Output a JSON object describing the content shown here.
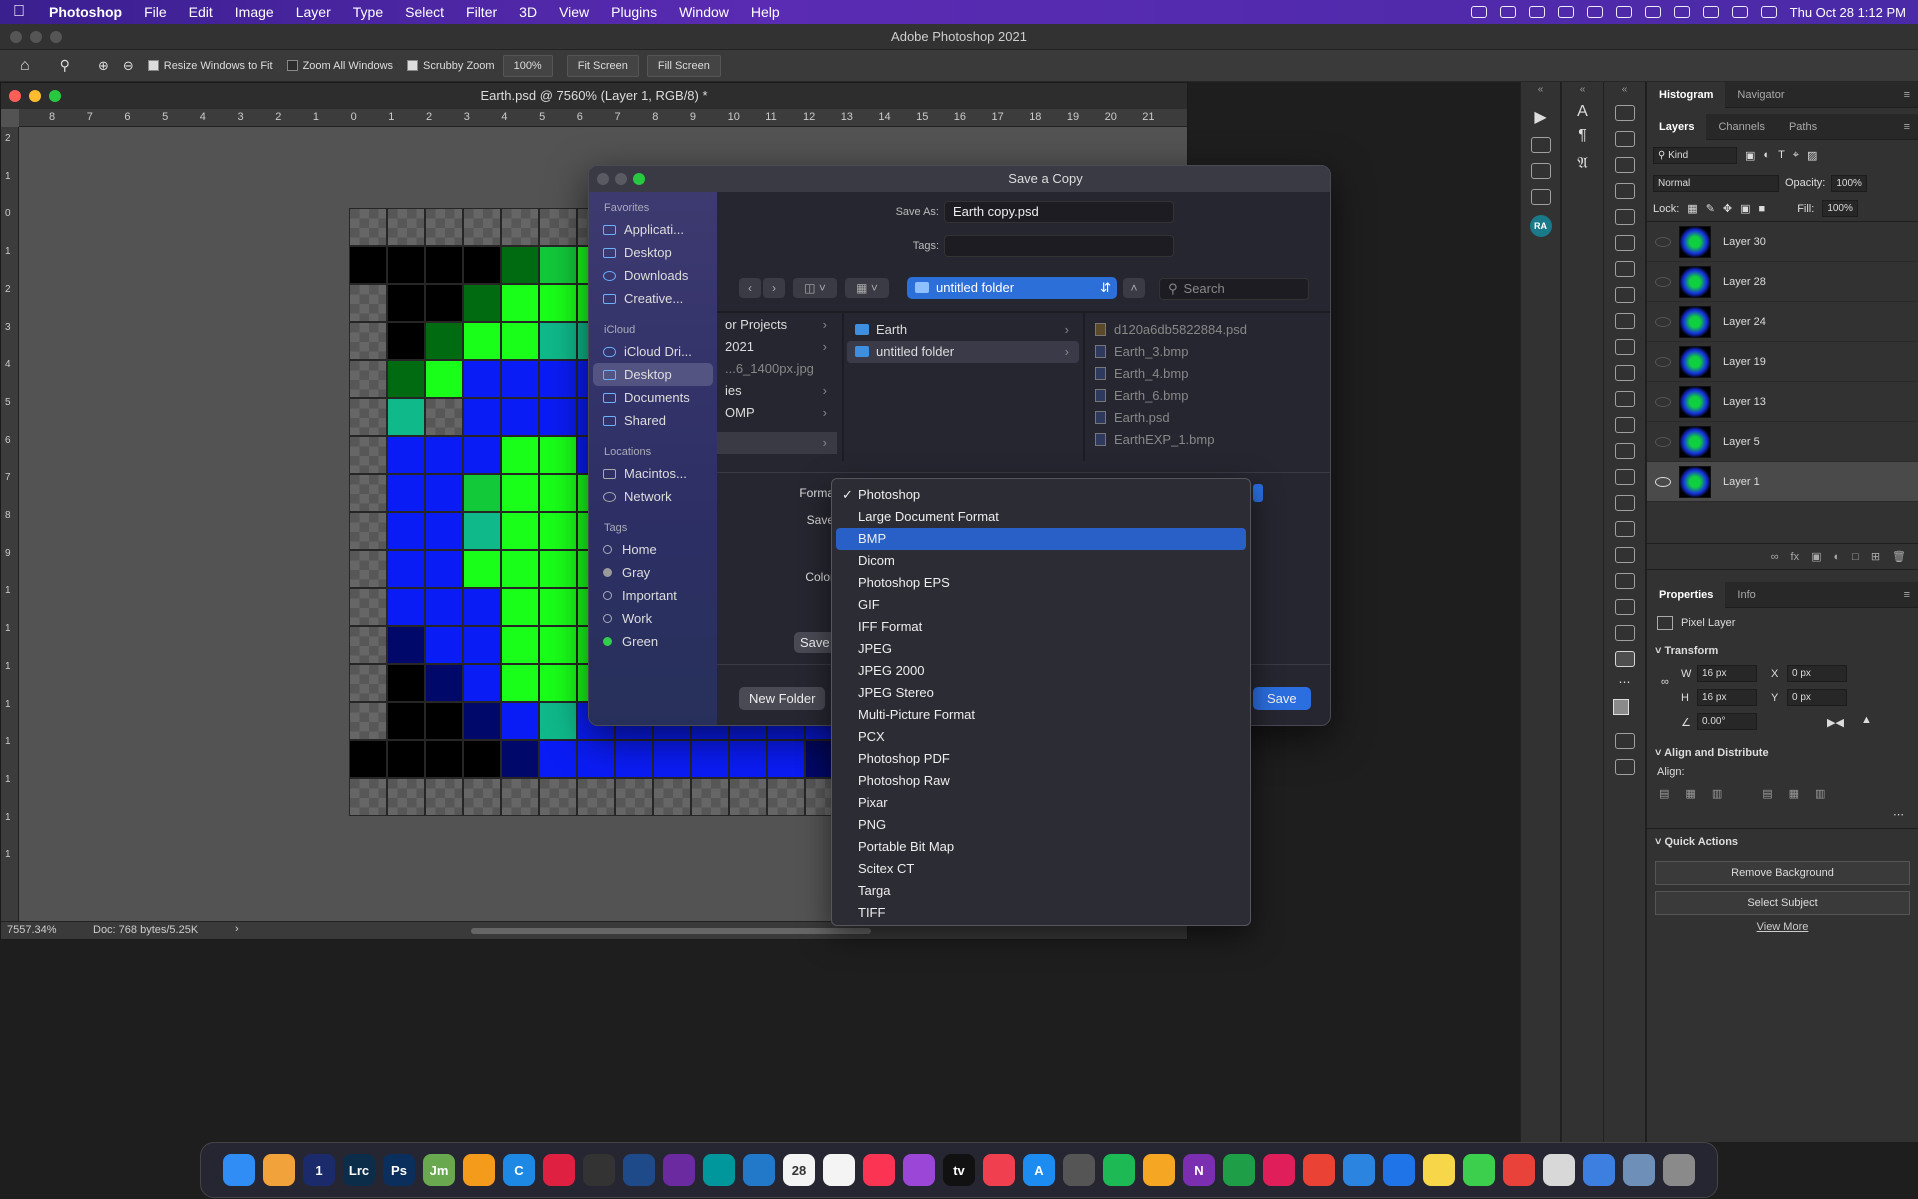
{
  "menubar": {
    "app": "Photoshop",
    "items": [
      "File",
      "Edit",
      "Image",
      "Layer",
      "Type",
      "Select",
      "Filter",
      "3D",
      "View",
      "Plugins",
      "Window",
      "Help"
    ],
    "clock": "Thu Oct 28  1:12 PM"
  },
  "app_title": "Adobe Photoshop 2021",
  "options": {
    "resize_windows": "Resize Windows to Fit",
    "zoom_all": "Zoom All Windows",
    "scrubby_zoom": "Scrubby Zoom",
    "zoom_value": "100%",
    "fit_screen": "Fit Screen",
    "fill_screen": "Fill Screen"
  },
  "document": {
    "tab_title": "Earth.psd @ 7560% (Layer 1, RGB/8) *",
    "ruler_h": [
      "8",
      "7",
      "6",
      "5",
      "4",
      "3",
      "2",
      "1",
      "0",
      "1",
      "2",
      "3",
      "4",
      "5",
      "6",
      "7",
      "8",
      "9",
      "10",
      "11",
      "12",
      "13",
      "14",
      "15",
      "16",
      "17",
      "18",
      "19",
      "20",
      "21"
    ],
    "ruler_v": [
      "2",
      "1",
      "0",
      "1",
      "2",
      "3",
      "4",
      "5",
      "6",
      "7",
      "8",
      "9",
      "1",
      "1",
      "1",
      "1",
      "1",
      "1",
      "1",
      "1"
    ],
    "zoom_status": "7557.34%",
    "doc_status": "Doc: 768 bytes/5.25K",
    "pixel_rows": [
      "cccccccccccccccc",
      "kkkkdglllggbkkkk",
      "ckkdlllbbbbbbkkc",
      "ckdllttbbbbbbbkc",
      "cdlbbbbbbbbbbbkc",
      "ctcbbbbbbbbbbbbc",
      "cbbbllbbbbbbbbbc",
      "cbbglllbbbbbbbbc",
      "cbbtlllbbbbbbbbc",
      "cbblllllbbbbbbbc",
      "cbbblllllbbbbbbc",
      "cnbbllllbbbbbbbc",
      "cknbllllbbbbbbbc",
      "ckknbtbbbbbbbnkc",
      "kkkknbbbbbbbnkkk",
      "cccccccccccccccc"
    ],
    "pixel_colors": {
      "c": "#5f5f5f",
      "k": "#000000",
      "d": "#006b10",
      "g": "#12c93a",
      "l": "#19ff19",
      "t": "#0fb98a",
      "b": "#0a1cf5",
      "n": "#00086a"
    }
  },
  "dialog": {
    "title": "Save a Copy",
    "save_as_label": "Save As:",
    "save_as_value": "Earth copy.psd",
    "tags_label": "Tags:",
    "location": "untitled folder",
    "search_placeholder": "Search",
    "sidebar": {
      "favorites_head": "Favorites",
      "favorites": [
        "Applicati...",
        "Desktop",
        "Downloads",
        "Creative..."
      ],
      "icloud_head": "iCloud",
      "icloud": [
        "iCloud Dri...",
        "Desktop",
        "Documents",
        "Shared"
      ],
      "locations_head": "Locations",
      "locations": [
        "Macintos...",
        "Network"
      ],
      "tags_head": "Tags",
      "tags": [
        {
          "name": "Home",
          "color": "#00000000"
        },
        {
          "name": "Gray",
          "color": "#9a9a9a"
        },
        {
          "name": "Important",
          "color": "#00000000"
        },
        {
          "name": "Work",
          "color": "#00000000"
        },
        {
          "name": "Green",
          "color": "#2fcf4b"
        }
      ]
    },
    "col1": [
      "or Projects",
      "2021",
      "...6_1400px.jpg",
      "ies",
      "OMP"
    ],
    "col2": [
      "Earth",
      "untitled folder"
    ],
    "col3": [
      "d120a6db5822884.psd",
      "Earth_3.bmp",
      "Earth_4.bmp",
      "Earth_6.bmp",
      "Earth.psd",
      "EarthEXP_1.bmp"
    ],
    "format_label": "Forma",
    "save_label": "Save",
    "color_label": "Color",
    "save_small": "Save",
    "new_folder": "New Folder",
    "save_button": "Save"
  },
  "format_menu": {
    "checked": "Photoshop",
    "items": [
      "Photoshop",
      "Large Document Format",
      "BMP",
      "Dicom",
      "Photoshop EPS",
      "GIF",
      "IFF Format",
      "JPEG",
      "JPEG 2000",
      "JPEG Stereo",
      "Multi-Picture Format",
      "PCX",
      "Photoshop PDF",
      "Photoshop Raw",
      "Pixar",
      "PNG",
      "Portable Bit Map",
      "Scitex CT",
      "Targa",
      "TIFF"
    ],
    "highlighted": "BMP"
  },
  "panels": {
    "top_tabs": [
      "Histogram",
      "Navigator"
    ],
    "layer_tabs": [
      "Layers",
      "Channels",
      "Paths"
    ],
    "kind": "Kind",
    "blend": "Normal",
    "opacity_label": "Opacity:",
    "opacity": "100%",
    "lock_label": "Lock:",
    "fill_label": "Fill:",
    "fill": "100%",
    "layers": [
      "Layer 30",
      "Layer 28",
      "Layer 24",
      "Layer 19",
      "Layer 13",
      "Layer 5",
      "Layer 1"
    ],
    "prop_tabs": [
      "Properties",
      "Info"
    ],
    "pixel_layer": "Pixel Layer",
    "transform": "Transform",
    "w_label": "W",
    "w": "16 px",
    "h_label": "H",
    "h": "16 px",
    "x_label": "X",
    "x": "0 px",
    "y_label": "Y",
    "y": "0 px",
    "angle": "0.00°",
    "align_head": "Align and Distribute",
    "align_label": "Align:",
    "quick_actions": "Quick Actions",
    "remove_bg": "Remove Background",
    "select_subject": "Select Subject",
    "view_more": "View More",
    "avatar": "RA"
  },
  "dock": [
    {
      "label": "",
      "color": "#2f8df5"
    },
    {
      "label": "",
      "color": "#f2a23a"
    },
    {
      "label": "1",
      "color": "#1b2a6b"
    },
    {
      "label": "Lrc",
      "color": "#0c2d4a"
    },
    {
      "label": "Ps",
      "color": "#0a2f5c"
    },
    {
      "label": "Jm",
      "color": "#6aa84f"
    },
    {
      "label": "",
      "color": "#f59b1c"
    },
    {
      "label": "C",
      "color": "#1e88e5"
    },
    {
      "label": "",
      "color": "#e02040"
    },
    {
      "label": "",
      "color": "#333333"
    },
    {
      "label": "",
      "color": "#1f4a8a"
    },
    {
      "label": "",
      "color": "#6b2aa0"
    },
    {
      "label": "",
      "color": "#00979c"
    },
    {
      "label": "",
      "color": "#2279c9"
    },
    {
      "label": "28",
      "color": "#f4f4f4"
    },
    {
      "label": "",
      "color": "#f4f4f4"
    },
    {
      "label": "",
      "color": "#fa3452"
    },
    {
      "label": "",
      "color": "#9b46d6"
    },
    {
      "label": "tv",
      "color": "#111111"
    },
    {
      "label": "",
      "color": "#f04050"
    },
    {
      "label": "A",
      "color": "#1d8cf0"
    },
    {
      "label": "",
      "color": "#555555"
    },
    {
      "label": "",
      "color": "#1db954"
    },
    {
      "label": "",
      "color": "#f5a623"
    },
    {
      "label": "N",
      "color": "#7b2fb0"
    },
    {
      "label": "",
      "color": "#1f9e48"
    },
    {
      "label": "",
      "color": "#e01e5a"
    },
    {
      "label": "",
      "color": "#ea4335"
    },
    {
      "label": "",
      "color": "#2a84e0"
    },
    {
      "label": "",
      "color": "#1f74e8"
    },
    {
      "label": "",
      "color": "#f7d64a"
    },
    {
      "label": "",
      "color": "#3ccf4e"
    },
    {
      "label": "",
      "color": "#e8423a"
    },
    {
      "label": "",
      "color": "#d8d8d8"
    },
    {
      "label": "",
      "color": "#3d7fe0"
    },
    {
      "label": "",
      "color": "#6d8fb8"
    },
    {
      "label": "",
      "color": "#8a8a8a"
    }
  ]
}
